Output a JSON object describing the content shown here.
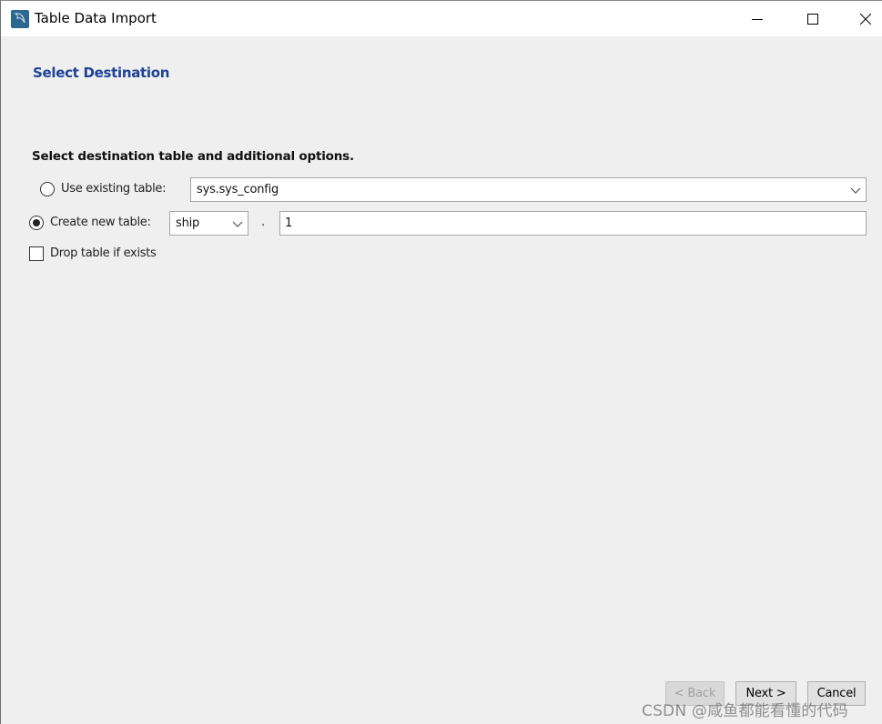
{
  "window": {
    "title": "Table Data Import",
    "controls": {
      "minimize": "minimize-icon",
      "maximize": "maximize-icon",
      "close": "close-icon"
    }
  },
  "page": {
    "title": "Select Destination",
    "heading": "Select destination table and additional options."
  },
  "options": {
    "use_existing": {
      "label": "Use existing table:",
      "selected": false,
      "value": "sys.sys_config"
    },
    "create_new": {
      "label": "Create new table:",
      "selected": true,
      "schema": "ship",
      "separator": ".",
      "table_name": "1"
    },
    "drop_if_exists": {
      "label": "Drop table if exists",
      "checked": false
    }
  },
  "buttons": {
    "back": "< Back",
    "next": "Next >",
    "cancel": "Cancel"
  },
  "watermark": "CSDN @咸鱼都能看懂的代码"
}
